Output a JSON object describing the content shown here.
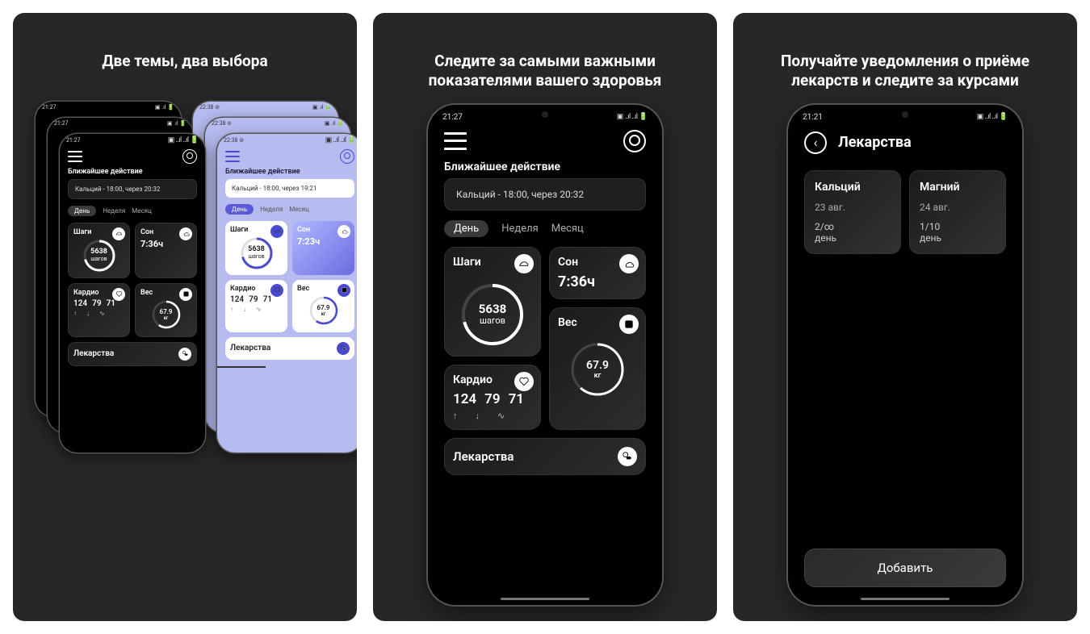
{
  "panel1": {
    "title": "Две темы, два выбора",
    "dark": {
      "time": "21:27",
      "section": "Ближайшее действие",
      "next_action": "Кальций - 18:00, через 20:32",
      "tabs": {
        "day": "День",
        "week": "Неделя",
        "month": "Месяц"
      },
      "steps": {
        "title": "Шаги",
        "value": "5638",
        "unit": "шагов"
      },
      "sleep": {
        "title": "Сон",
        "value": "7:36ч"
      },
      "cardio": {
        "title": "Кардио",
        "v1": "124",
        "v2": "79",
        "v3": "71"
      },
      "weight": {
        "title": "Вес",
        "value": "67.9",
        "unit": "кг"
      },
      "meds": "Лекарства"
    },
    "light": {
      "time": "22:38",
      "section": "Ближайшее действие",
      "next_action": "Кальций - 18:00, через 19:21",
      "tabs": {
        "day": "День",
        "week": "Неделя",
        "month": "Месяц"
      },
      "steps": {
        "title": "Шаги",
        "value": "5638",
        "unit": "шагов"
      },
      "sleep": {
        "title": "Сон",
        "value": "7:23ч"
      },
      "cardio": {
        "title": "Кардио",
        "v1": "124",
        "v2": "79",
        "v3": "71"
      },
      "weight": {
        "title": "Вес",
        "value": "67.9",
        "unit": "кг"
      },
      "meds": "Лекарства"
    }
  },
  "panel2": {
    "title": "Следите за самыми важными показателями вашего здоровья",
    "time": "21:27",
    "section": "Ближайшее действие",
    "next_action": "Кальций - 18:00, через 20:32",
    "tabs": {
      "day": "День",
      "week": "Неделя",
      "month": "Месяц"
    },
    "steps": {
      "title": "Шаги",
      "value": "5638",
      "unit": "шагов"
    },
    "sleep": {
      "title": "Сон",
      "value": "7:36ч"
    },
    "cardio": {
      "title": "Кардио",
      "v1": "124",
      "v2": "79",
      "v3": "71"
    },
    "weight": {
      "title": "Вес",
      "value": "67.9",
      "unit": "кг"
    },
    "meds": "Лекарства"
  },
  "panel3": {
    "title": "Получайте уведомления о приёме лекарств и следите за курсами",
    "time": "21:21",
    "screen_title": "Лекарства",
    "meds": [
      {
        "name": "Кальций",
        "date": "23 авг.",
        "count": "2/∞",
        "unit": "день"
      },
      {
        "name": "Магний",
        "date": "24 авг.",
        "count": "1/10",
        "unit": "день"
      }
    ],
    "add": "Добавить"
  },
  "status_icons": "▣ ..ıl ..ıl 🔋"
}
